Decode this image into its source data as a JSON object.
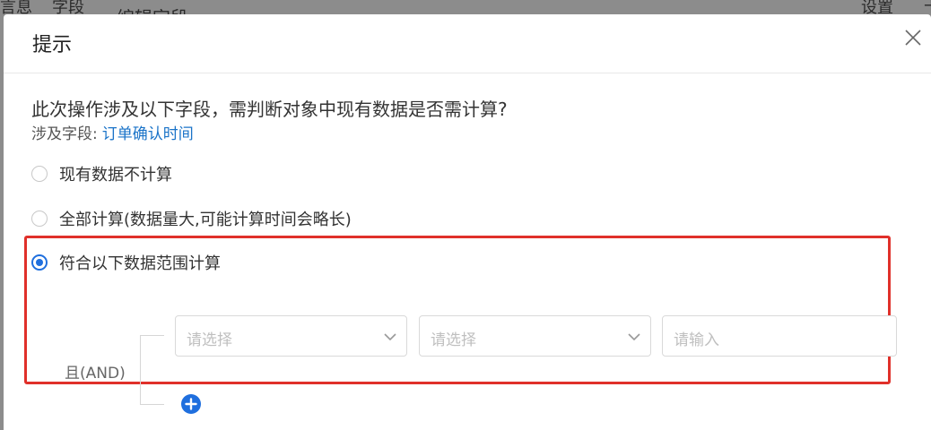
{
  "background": {
    "top_left_text": "言息",
    "tab_field": "字段",
    "partial_title": "编辑字段",
    "settings": "设置",
    "right_edge": "卡"
  },
  "dialog": {
    "title": "提示",
    "close_icon": "close-icon",
    "question": "此次操作涉及以下字段，需判断对象中现有数据是否需计算?",
    "fields_prefix": "涉及字段:",
    "field_link": "订单确认时间",
    "options": [
      {
        "label": "现有数据不计算",
        "checked": false
      },
      {
        "label": "全部计算(数据量大,可能计算时间会略长)",
        "checked": false
      },
      {
        "label": "符合以下数据范围计算",
        "checked": true
      }
    ],
    "condition": {
      "and_label": "且(AND)",
      "field_select_placeholder": "请选择",
      "operator_select_placeholder": "请选择",
      "value_input_placeholder": "请输入",
      "add_icon": "plus-circle-icon"
    }
  },
  "colors": {
    "accent": "#1f6fde",
    "link": "#1a73c8",
    "highlight": "#e0302a"
  }
}
